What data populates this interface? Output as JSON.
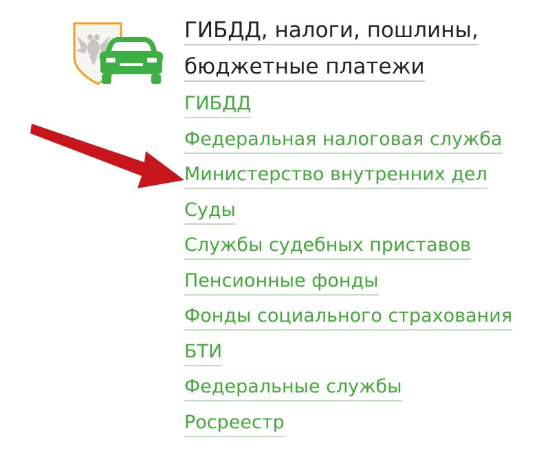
{
  "category": {
    "icon": "traffic-police-car-icon",
    "title_lines": [
      "ГИБДД, налоги, пошлины,",
      "бюджетные платежи"
    ]
  },
  "links": [
    {
      "label": "ГИБДД"
    },
    {
      "label": "Федеральная налоговая служба"
    },
    {
      "label": "Министерство внутренних дел"
    },
    {
      "label": "Суды"
    },
    {
      "label": "Службы судебных приставов"
    },
    {
      "label": "Пенсионные фонды"
    },
    {
      "label": "Фонды социального страхования"
    },
    {
      "label": "БТИ"
    },
    {
      "label": "Федеральные службы"
    },
    {
      "label": "Росреестр"
    }
  ],
  "annotation": {
    "icon": "red-pointer-arrow-icon",
    "points_to_link": "Министерство внутренних дел"
  },
  "colors": {
    "link": "#43a83a",
    "link_underline": "#c2dec0",
    "title_text": "#222222",
    "arrow": "#c8161d",
    "shield_border": "#f2a11e",
    "car": "#3cb043"
  }
}
